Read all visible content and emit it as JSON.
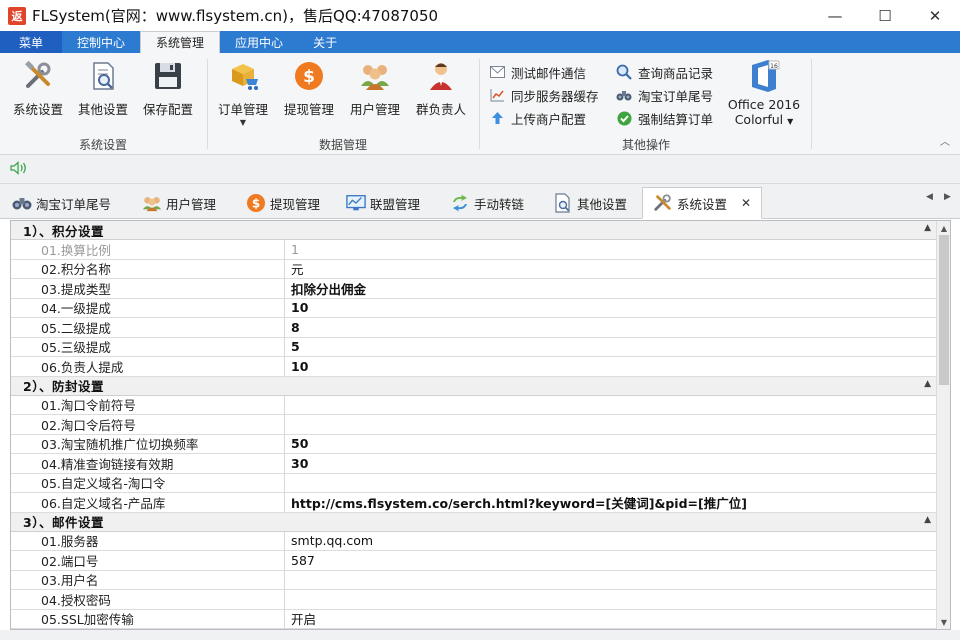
{
  "window": {
    "app_icon_text": "返",
    "title": "FLSystem(官网：www.flsystem.cn)，售后QQ:47087050",
    "minimize": "—",
    "maximize": "☐",
    "close": "✕"
  },
  "menu_tabs": [
    "菜单",
    "控制中心",
    "系统管理",
    "应用中心",
    "关于"
  ],
  "ribbon": {
    "system_group": {
      "label": "系统设置",
      "buttons": [
        "系统设置",
        "其他设置",
        "保存配置"
      ]
    },
    "data_group": {
      "label": "数据管理",
      "buttons": [
        "订单管理",
        "提现管理",
        "用户管理",
        "群负责人"
      ]
    },
    "other_group": {
      "label": "其他操作",
      "small_buttons": [
        "测试邮件通信",
        "同步服务器缓存",
        "上传商户配置",
        "查询商品记录",
        "淘宝订单尾号",
        "强制结算订单"
      ],
      "office_line1": "Office 2016",
      "office_line2": "Colorful",
      "office_badge": "16"
    }
  },
  "doc_tabs": [
    "淘宝订单尾号",
    "用户管理",
    "提现管理",
    "联盟管理",
    "手动转链",
    "其他设置",
    "系统设置"
  ],
  "doc_tab_close": "✕",
  "grid": {
    "sections": [
      {
        "title": "1）、积分设置",
        "rows": [
          {
            "name": "01.换算比例",
            "value": "1",
            "disabled": true
          },
          {
            "name": "02.积分名称",
            "value": "元",
            "bold": false
          },
          {
            "name": "03.提成类型",
            "value": "扣除分出佣金",
            "bold": true
          },
          {
            "name": "04.一级提成",
            "value": "10",
            "bold": true
          },
          {
            "name": "05.二级提成",
            "value": "8",
            "bold": true
          },
          {
            "name": "05.三级提成",
            "value": "5",
            "bold": true
          },
          {
            "name": "06.负责人提成",
            "value": "10",
            "bold": true
          }
        ]
      },
      {
        "title": "2）、防封设置",
        "rows": [
          {
            "name": "01.淘口令前符号",
            "value": ""
          },
          {
            "name": "02.淘口令后符号",
            "value": ""
          },
          {
            "name": "03.淘宝随机推广位切换频率",
            "value": "50",
            "bold": true
          },
          {
            "name": "04.精准查询链接有效期",
            "value": "30",
            "bold": true
          },
          {
            "name": "05.自定义域名-淘口令",
            "value": ""
          },
          {
            "name": "06.自定义域名-产品库",
            "value": "http://cms.flsystem.co/serch.html?keyword=[关健词]&pid=[推广位]",
            "bold": true
          }
        ]
      },
      {
        "title": "3）、邮件设置",
        "rows": [
          {
            "name": "01.服务器",
            "value": "smtp.qq.com"
          },
          {
            "name": "02.端口号",
            "value": "587"
          },
          {
            "name": "03.用户名",
            "value": ""
          },
          {
            "name": "04.授权密码",
            "value": ""
          },
          {
            "name": "05.SSL加密传输",
            "value": "开启"
          }
        ]
      }
    ]
  },
  "colors": {
    "menu_blue": "#2d7ad1",
    "ribbon_bg": "#f5f6f7",
    "app_icon_red": "#e0452b"
  }
}
